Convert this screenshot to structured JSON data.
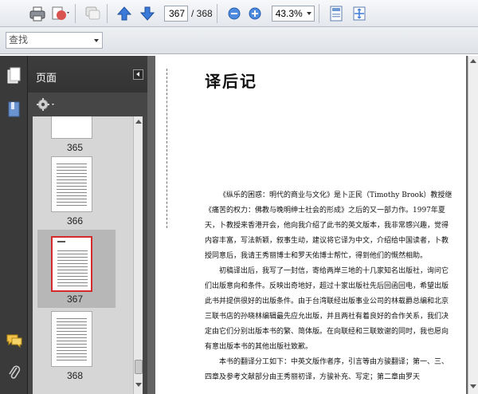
{
  "toolbar": {
    "current_page": "367",
    "total_pages": "/ 368",
    "zoom": "43.3%",
    "icons": [
      "print-icon",
      "share-icon",
      "comment-icon",
      "prev-page-icon",
      "next-page-icon",
      "zoom-out-icon",
      "zoom-in-icon",
      "fit-page-icon",
      "fullscreen-icon"
    ]
  },
  "find": {
    "placeholder": "查找"
  },
  "panel": {
    "title": "页面",
    "thumbnails": [
      {
        "label": "365",
        "selected": false
      },
      {
        "label": "366",
        "selected": false
      },
      {
        "label": "367",
        "selected": true
      },
      {
        "label": "368",
        "selected": false
      }
    ]
  },
  "document": {
    "title": "译后记",
    "paragraphs": [
      "《纵乐的困惑：明代的商业与文化》是卜正民（Timothy Brook）教授继《痛苦的权力：佛教与晚明绅士社会的形成》之后的又一部力作。1997年夏天，卜教授来香港开会，他向我介绍了此书的英文版本，我非常感兴趣，觉得内容丰富，写法新颖，叙事生动，建议将它译为中文，介绍给中国读者，卜教授同意后，我请王秀丽博士和罗天佑博士帮忙，得到他们的慨然相助。",
      "初稿译出后，我写了一封信，寄给两岸三地的十几家知名出版社，询问它们出版意向和条件。反映出奇地好，超过十家出版社先后回函回电，希望出版此书并提供很好的出版条件。由于台湾联经出版事业公司的林载爵总编和北京三联书店的孙晓林编辑最先应允出版，并且两社有着良好的合作关系，我们决定由它们分别出版本书的繁、简体版。在向联经和三联致谢的同时，我也愿向有意出版本书的其他出版社致歉。",
      "本书的翻译分工如下：中英文版作者序，引言等由方骏翻译；第一、三、四章及参考文献部分由王秀丽初译，方骏补充、写定；第二章由罗天"
    ]
  }
}
